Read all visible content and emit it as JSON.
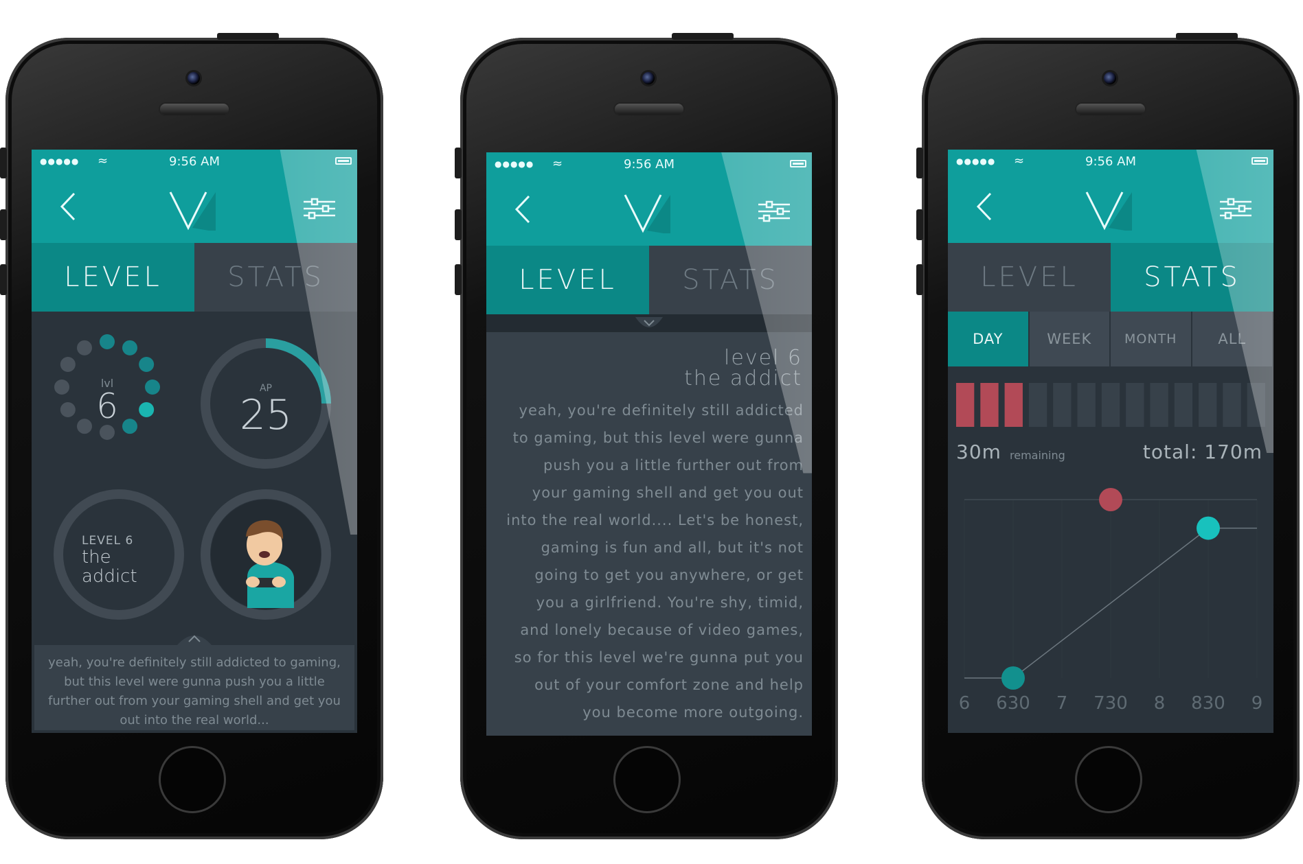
{
  "colors": {
    "teal": "#0f9e9c",
    "teal_dark": "#0b8886",
    "screen_bg": "#2a333b",
    "panel": "#37414a",
    "accent_red": "#b24a57",
    "accent_cyan": "#18c1bd"
  },
  "status": {
    "time": "9:56 AM",
    "signal": "●●●●●"
  },
  "tabs": {
    "level": "LEVEL",
    "stats": "STATS"
  },
  "phone1": {
    "level_small": "lvl",
    "level_value": "6",
    "level_progress_fraction": 0.25,
    "ap_label": "AP",
    "ap_value": "25",
    "ap_progress_fraction": 0.25,
    "badge_title": "LEVEL 6",
    "badge_name": "the addict",
    "description": "yeah, you're definitely still addicted to gaming, but this level were gunna push you a little further out from your gaming shell and get you out into the real world..."
  },
  "phone2": {
    "level_title": "level 6",
    "level_name": "the addict",
    "lines": [
      "yeah, you're definitely still addicted",
      "to gaming, but this level were gunna",
      "push you a little further out from",
      "your gaming shell and get you out",
      "into the real world.... Let's be honest,",
      "gaming is fun and all, but it's not",
      "going to get you anywhere, or get",
      "you a girlfriend. You're shy, timid,",
      "and lonely because of video games,",
      "so for this level we're gunna put you",
      "out of your comfort zone and help",
      "you become more outgoing."
    ]
  },
  "phone3": {
    "ranges": [
      "DAY",
      "WEEK",
      "MONTH",
      "ALL"
    ],
    "active_range": "DAY",
    "used_blocks": 3,
    "total_blocks": 13,
    "remaining_value": "30m",
    "remaining_label": "remaining",
    "total_text": "total: 170m",
    "chart_data": {
      "type": "line",
      "x_ticks": [
        "6",
        "630",
        "7",
        "730",
        "8",
        "830",
        "9"
      ],
      "points": [
        {
          "x": "630",
          "y": 0,
          "color": "cyan"
        },
        {
          "x": "830",
          "y": 0.84,
          "color": "cyan"
        }
      ],
      "limit_marker": {
        "x": "730",
        "y": 1.0,
        "color": "red"
      }
    }
  },
  "icons": {
    "back": "chevron-left-icon",
    "logo": "v-logo-icon",
    "settings": "sliders-icon",
    "wifi": "wifi-icon",
    "battery": "battery-icon",
    "collapse": "chevron-up-icon",
    "expand": "chevron-down-icon"
  }
}
